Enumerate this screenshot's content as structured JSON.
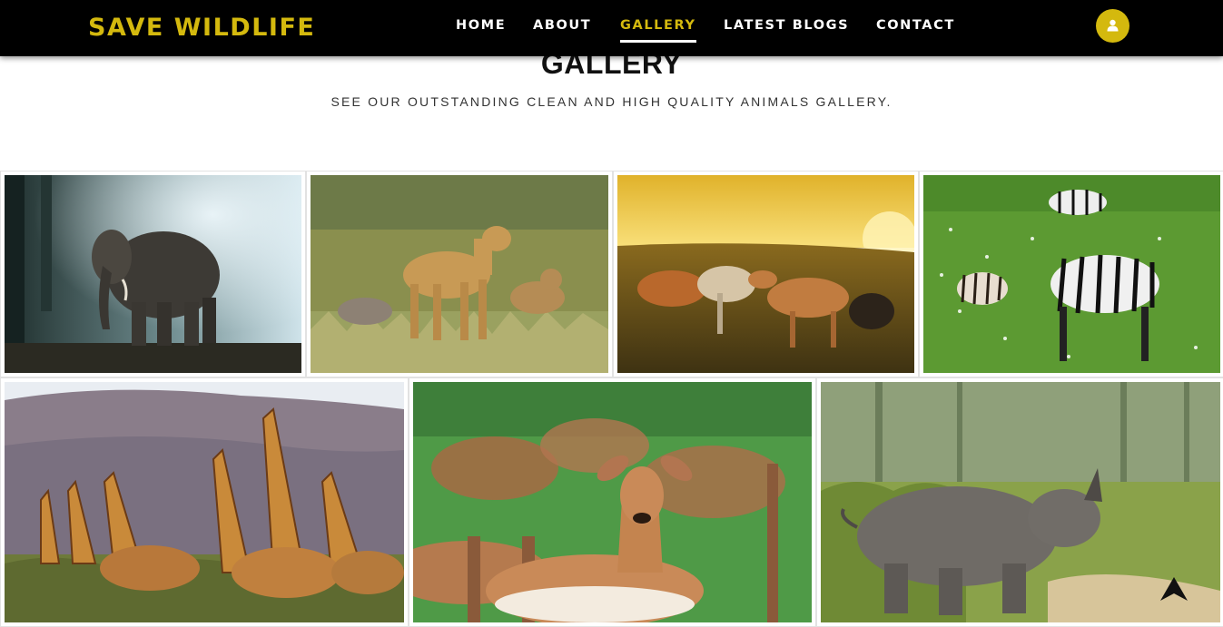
{
  "brand": "SAVE WILDLIFE",
  "nav": {
    "items": [
      {
        "label": "HOME",
        "active": false
      },
      {
        "label": "ABOUT",
        "active": false
      },
      {
        "label": "GALLERY",
        "active": true
      },
      {
        "label": "LATEST BLOGS",
        "active": false
      },
      {
        "label": "CONTACT",
        "active": false
      }
    ],
    "user_icon": "user-icon"
  },
  "gallery": {
    "title": "GALLERY",
    "subtitle": "SEE OUR OUTSTANDING CLEAN AND HIGH QUALITY ANIMALS GALLERY.",
    "images": [
      {
        "subject": "elephant"
      },
      {
        "subject": "cheetahs"
      },
      {
        "subject": "horses"
      },
      {
        "subject": "zebras"
      },
      {
        "subject": "giraffes"
      },
      {
        "subject": "impalas"
      },
      {
        "subject": "rhinoceros"
      }
    ]
  },
  "scroll_top_icon": "arrow-up-icon",
  "colors": {
    "accent": "#d4b90e",
    "navbar": "#000000",
    "text": "#111111"
  }
}
